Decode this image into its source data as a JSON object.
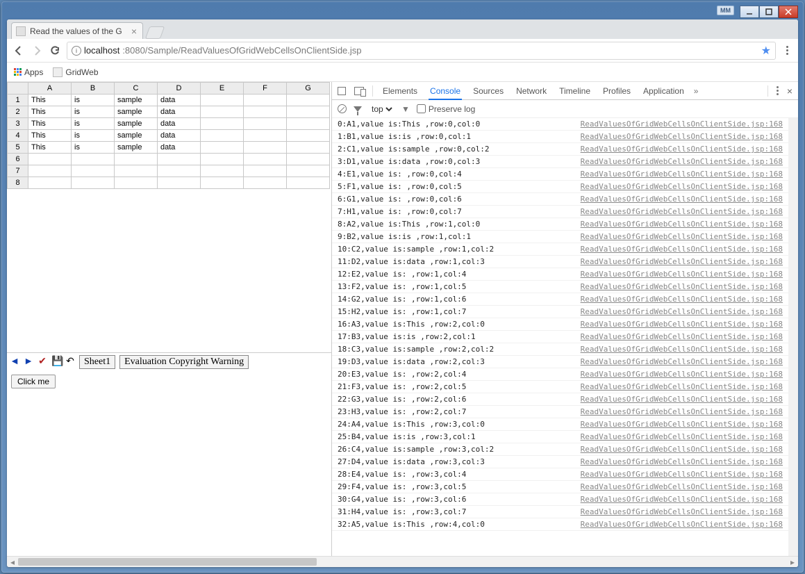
{
  "window": {
    "monitor_tag": "MM"
  },
  "browser_tab": {
    "title": "Read the values of the G"
  },
  "url": {
    "host": "localhost",
    "port_path": ":8080/Sample/ReadValuesOfGridWebCellsOnClientSide.jsp"
  },
  "bookmarks": {
    "apps_label": "Apps",
    "items": [
      "GridWeb"
    ]
  },
  "grid": {
    "columns": [
      "A",
      "B",
      "C",
      "D",
      "E",
      "F",
      "G"
    ],
    "row_headers": [
      "1",
      "2",
      "3",
      "4",
      "5",
      "6",
      "7",
      "8"
    ],
    "rows": [
      [
        "This",
        "is",
        "sample",
        "data",
        "",
        "",
        ""
      ],
      [
        "This",
        "is",
        "sample",
        "data",
        "",
        "",
        ""
      ],
      [
        "This",
        "is",
        "sample",
        "data",
        "",
        "",
        ""
      ],
      [
        "This",
        "is",
        "sample",
        "data",
        "",
        "",
        ""
      ],
      [
        "This",
        "is",
        "sample",
        "data",
        "",
        "",
        ""
      ],
      [
        "",
        "",
        "",
        "",
        "",
        "",
        ""
      ],
      [
        "",
        "",
        "",
        "",
        "",
        "",
        ""
      ],
      [
        "",
        "",
        "",
        "",
        "",
        "",
        ""
      ]
    ]
  },
  "sheetbar": {
    "sheet1": "Sheet1",
    "warning": "Evaluation Copyright Warning"
  },
  "button": {
    "click_me": "Click me"
  },
  "devtools": {
    "tabs": [
      "Elements",
      "Console",
      "Sources",
      "Network",
      "Timeline",
      "Profiles",
      "Application"
    ],
    "active_tab": "Console",
    "filter_scope": "top",
    "preserve_log_label": "Preserve log",
    "source_link": "ReadValuesOfGridWebCellsOnClientSide.jsp:168",
    "log_lines": [
      "0:A1,value is:This ,row:0,col:0",
      "1:B1,value is:is ,row:0,col:1",
      "2:C1,value is:sample ,row:0,col:2",
      "3:D1,value is:data ,row:0,col:3",
      "4:E1,value is: ,row:0,col:4",
      "5:F1,value is: ,row:0,col:5",
      "6:G1,value is: ,row:0,col:6",
      "7:H1,value is: ,row:0,col:7",
      "8:A2,value is:This ,row:1,col:0",
      "9:B2,value is:is ,row:1,col:1",
      "10:C2,value is:sample ,row:1,col:2",
      "11:D2,value is:data ,row:1,col:3",
      "12:E2,value is: ,row:1,col:4",
      "13:F2,value is: ,row:1,col:5",
      "14:G2,value is: ,row:1,col:6",
      "15:H2,value is: ,row:1,col:7",
      "16:A3,value is:This ,row:2,col:0",
      "17:B3,value is:is ,row:2,col:1",
      "18:C3,value is:sample ,row:2,col:2",
      "19:D3,value is:data ,row:2,col:3",
      "20:E3,value is: ,row:2,col:4",
      "21:F3,value is: ,row:2,col:5",
      "22:G3,value is: ,row:2,col:6",
      "23:H3,value is: ,row:2,col:7",
      "24:A4,value is:This ,row:3,col:0",
      "25:B4,value is:is ,row:3,col:1",
      "26:C4,value is:sample ,row:3,col:2",
      "27:D4,value is:data ,row:3,col:3",
      "28:E4,value is: ,row:3,col:4",
      "29:F4,value is: ,row:3,col:5",
      "30:G4,value is: ,row:3,col:6",
      "31:H4,value is: ,row:3,col:7",
      "32:A5,value is:This ,row:4,col:0"
    ]
  }
}
